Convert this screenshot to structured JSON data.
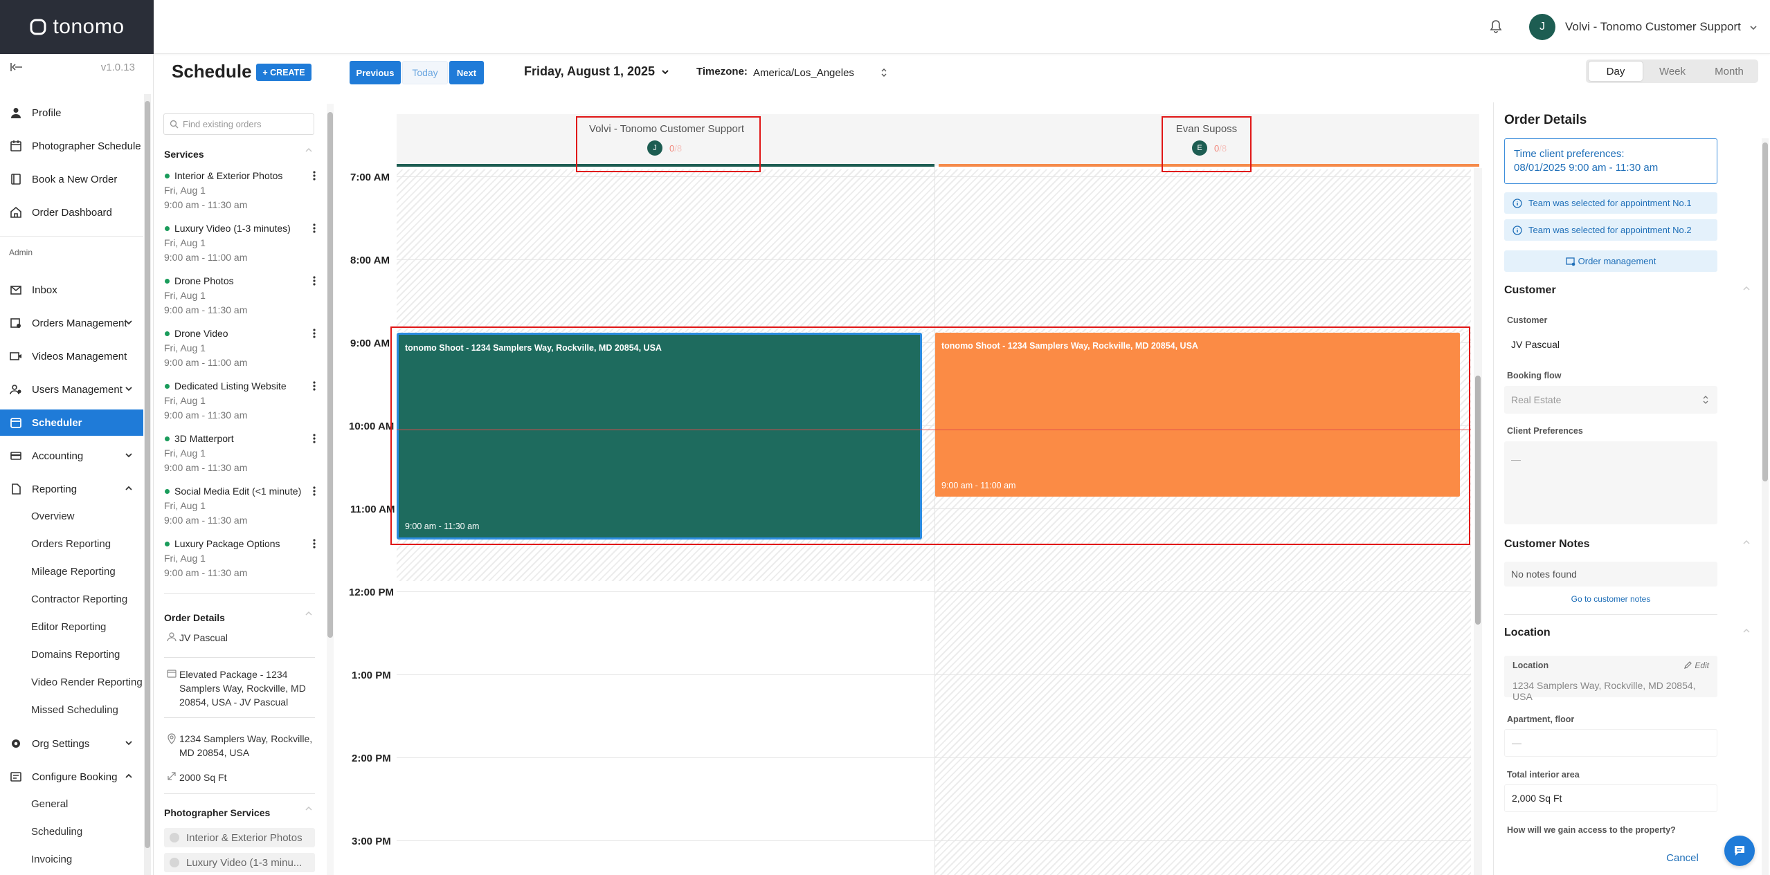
{
  "app": {
    "logo": "tonomo",
    "version": "v1.0.13"
  },
  "nav": {
    "items": [
      {
        "label": "Profile",
        "icon": "person-icon"
      },
      {
        "label": "Photographer Schedule",
        "icon": "calendar-icon"
      },
      {
        "label": "Book a New Order",
        "icon": "book-icon"
      },
      {
        "label": "Order Dashboard",
        "icon": "home-icon"
      }
    ],
    "admin_label": "Admin",
    "admin_items": [
      {
        "label": "Inbox",
        "icon": "mail-icon"
      },
      {
        "label": "Orders Management",
        "icon": "orders-icon"
      },
      {
        "label": "Videos Management",
        "icon": "video-icon"
      },
      {
        "label": "Users Management",
        "icon": "users-icon"
      },
      {
        "label": "Scheduler",
        "icon": "scheduler-icon"
      },
      {
        "label": "Accounting",
        "icon": "accounting-icon"
      },
      {
        "label": "Reporting",
        "icon": "reporting-icon"
      }
    ],
    "reporting_sub": [
      "Overview",
      "Orders Reporting",
      "Mileage Reporting",
      "Contractor Reporting",
      "Editor Reporting",
      "Domains Reporting",
      "Video Render Reporting",
      "Missed Scheduling"
    ],
    "org_settings": "Org Settings",
    "configure_booking": "Configure Booking",
    "configure_sub": [
      "General",
      "Scheduling",
      "Invoicing"
    ]
  },
  "header": {
    "user_initial": "J",
    "user_name": "Volvi - Tonomo Customer Support"
  },
  "toolbar": {
    "title": "Schedule",
    "create": "+ CREATE",
    "previous": "Previous",
    "today": "Today",
    "next": "Next",
    "date": "Friday, August 1, 2025",
    "timezone_label": "Timezone:",
    "timezone_value": "America/Los_Angeles",
    "views": [
      "Day",
      "Week",
      "Month"
    ],
    "active_view": "Day"
  },
  "services_panel": {
    "search_placeholder": "Find existing orders",
    "services_title": "Services",
    "services": [
      {
        "name": "Interior & Exterior Photos",
        "date": "Fri, Aug 1",
        "time": "9:00 am - 11:30 am"
      },
      {
        "name": "Luxury Video (1-3 minutes)",
        "date": "Fri, Aug 1",
        "time": "9:00 am - 11:00 am"
      },
      {
        "name": "Drone Photos",
        "date": "Fri, Aug 1",
        "time": "9:00 am - 11:30 am"
      },
      {
        "name": "Drone Video",
        "date": "Fri, Aug 1",
        "time": "9:00 am - 11:00 am"
      },
      {
        "name": "Dedicated Listing Website",
        "date": "Fri, Aug 1",
        "time": "9:00 am - 11:30 am"
      },
      {
        "name": "3D Matterport",
        "date": "Fri, Aug 1",
        "time": "9:00 am - 11:30 am"
      },
      {
        "name": "Social Media Edit (<1 minute)",
        "date": "Fri, Aug 1",
        "time": "9:00 am - 11:30 am"
      },
      {
        "name": "Luxury Package Options",
        "date": "Fri, Aug 1",
        "time": "9:00 am - 11:30 am"
      }
    ],
    "order_details_title": "Order Details",
    "customer": "JV Pascual",
    "package": "Elevated Package - 1234 Samplers Way, Rockville, MD 20854, USA - JV Pascual",
    "address": "1234 Samplers Way, Rockville, MD 20854, USA",
    "area": "2000 Sq Ft",
    "photographer_services_title": "Photographer Services",
    "photographer_services": [
      "Interior & Exterior Photos",
      "Luxury Video (1-3 minu..."
    ]
  },
  "calendar": {
    "columns": [
      {
        "name": "Volvi - Tonomo Customer Support",
        "initial": "J",
        "count": "0",
        "count_total": "/8",
        "color": "#1d5d52"
      },
      {
        "name": "Evan Suposs",
        "initial": "E",
        "count": "0",
        "count_total": "/8",
        "color": "#f58a4a"
      }
    ],
    "hours": [
      "7:00 AM",
      "8:00 AM",
      "9:00 AM",
      "10:00 AM",
      "11:00 AM",
      "12:00 PM",
      "1:00 PM",
      "2:00 PM",
      "3:00 PM"
    ],
    "events": [
      {
        "title": "tonomo Shoot - 1234 Samplers Way, Rockville, MD 20854, USA",
        "time": "9:00 am - 11:30 am",
        "color": "#1e6b5e"
      },
      {
        "title": "tonomo Shoot - 1234 Samplers Way, Rockville, MD 20854, USA",
        "time": "9:00 am - 11:00 am",
        "color": "#fb8b45"
      }
    ]
  },
  "right_panel": {
    "title": "Order Details",
    "pref_title": "Time client preferences:",
    "pref_value": "08/01/2025 9:00 am - 11:30 am",
    "info1": "Team was selected for appointment No.1",
    "info2": "Team was selected for appointment No.2",
    "order_management": "Order management",
    "customer_title": "Customer",
    "customer_label": "Customer",
    "customer_value": "JV Pascual",
    "booking_flow_label": "Booking flow",
    "booking_flow_value": "Real Estate",
    "client_pref_label": "Client Preferences",
    "client_pref_value": "—",
    "notes_title": "Customer Notes",
    "notes_value": "No notes found",
    "notes_link": "Go to customer notes",
    "location_title": "Location",
    "location_label": "Location",
    "edit": "Edit",
    "location_value": "1234 Samplers Way, Rockville, MD 20854, USA",
    "apt_label": "Apartment, floor",
    "apt_value": "—",
    "area_label": "Total interior area",
    "area_value": "2,000 Sq Ft",
    "access_label": "How will we gain access to the property?",
    "cancel": "Cancel"
  }
}
